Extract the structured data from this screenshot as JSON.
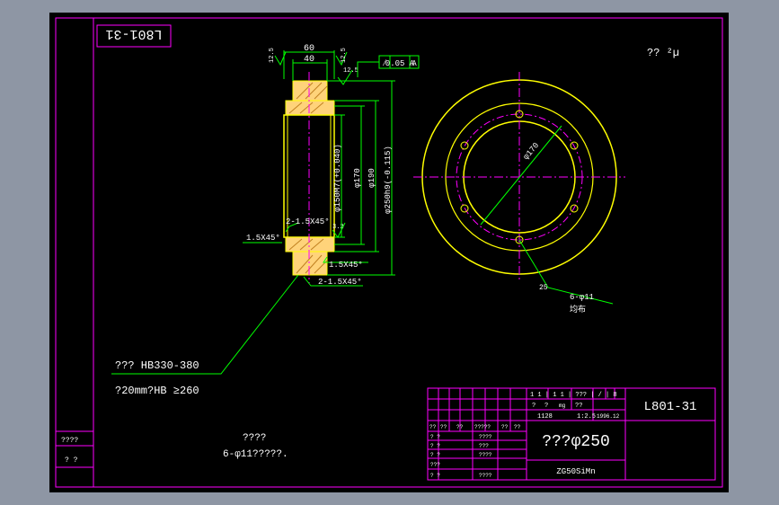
{
  "drawing": {
    "stamp": "L801-31",
    "roughness_symbol": "?? ²µ"
  },
  "section_view": {
    "dim_60": "60",
    "dim_40": "40",
    "roughness_top_left": "12.5",
    "roughness_top_right": "12.5",
    "roughness_right": "12.5",
    "roughness_small": "3.2",
    "tolerance_box": "0.05 A",
    "tolerance_symbol": "∕",
    "datum": "A",
    "dia_150": "φ150M7(+0.040)",
    "dia_170": "φ170",
    "dia_190": "φ190",
    "dia_250": "φ250h9(-0.115)",
    "chamfer_1": "2-1.5X45°",
    "chamfer_2": "1.5X45°",
    "chamfer_3": "1.5X45°",
    "chamfer_4": "2-1.5X45°"
  },
  "plan_view": {
    "dia_170": "φ170",
    "roughness": "25",
    "holes": "6-φ11",
    "distribution": "均布"
  },
  "notes": {
    "line1": "??? HB330-380",
    "line2": "?20mm?HB ≥260",
    "title": "????",
    "line3": "6-φ11?????."
  },
  "title_block": {
    "drawing_no": "L801-31",
    "part_name": "???φ250",
    "material": "ZG50SiMn",
    "scale_header": "1 1 | 1 1 | ??? | / | 8",
    "mass": "1128",
    "scale": "1:2.5",
    "date": "1996.12",
    "row_labels": [
      "??",
      "??",
      "??",
      "?????",
      "??",
      "??"
    ],
    "left_rows": [
      "? ?",
      "? ?",
      "? ?",
      "???",
      "? ?"
    ],
    "mid_rows": [
      "????",
      "???",
      "????",
      "????"
    ],
    "approve_cells": [
      "?",
      "?",
      "mg",
      "??"
    ]
  },
  "side_block": {
    "row1": "????",
    "row2": "?  ?"
  },
  "colors": {
    "background": "#8e96a4",
    "paper": "#000000",
    "frame": "#ff00ff",
    "outline": "#ffff00",
    "dimension": "#00ff00",
    "center_line": "#ff00ff",
    "text": "#ffffff"
  }
}
